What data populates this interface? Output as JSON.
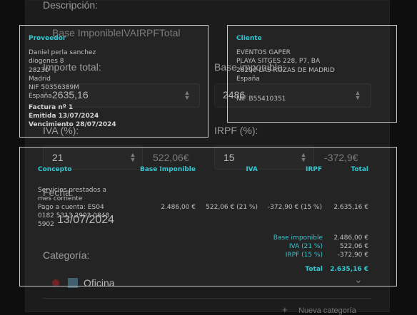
{
  "form": {
    "descripcion_label": "Descripción:",
    "base_header": "Base ImponibleIVAIRPFTotal",
    "importe_total_label": "Importe total:",
    "importe_total_value": "2635,16",
    "base_imponible_label": "Base imponible:",
    "base_imponible_value": "2486",
    "iva_label": "IVA (%):",
    "iva_value": "21",
    "iva_amount": "522,06€",
    "irpf_label": "IRPF (%):",
    "irpf_value": "15",
    "irpf_amount": "-372,9€",
    "fecha_label": "Fecha:",
    "fecha_value": "13/07/2024",
    "categoria_label": "Categoría:",
    "categoria_value": "Oficina",
    "nueva_categoria": "Nueva categoría",
    "plus_glyph": "+",
    "chevron_glyph": "⌄"
  },
  "invoice": {
    "proveedor": {
      "heading": "Proveedor",
      "lines": [
        "Daniel perla sanchez",
        "diogenes 8",
        "28230",
        "Madrid",
        "NIF 50356389M",
        "España"
      ],
      "factura": "Factura nº 1",
      "emitida": "Emitida 13/07/2024",
      "vencimiento": "Vencimiento 28/07/2024"
    },
    "cliente": {
      "heading": "Cliente",
      "lines": [
        "EVENTOS GAPER",
        "PLAYA SITGES 228, P7, BA",
        "28290 LAS ROZAS DE MADRID",
        "España",
        "",
        "NIF B55410351"
      ]
    },
    "table": {
      "headers": [
        "Concepto",
        "Base Imponible",
        "IVA",
        "IRPF",
        "Total"
      ],
      "concepto_lines": [
        "Servicios prestados a",
        "mes corriente",
        "Pago a cuenta: ES04",
        "0182 5313 2903 0848",
        "5902"
      ],
      "base": "2.486,00 €",
      "iva": "522,06 € (21 %)",
      "irpf": "-372,90 € (15 %)",
      "total": "2.635,16 €"
    },
    "summary": {
      "base_label": "Base imponible",
      "base_value": "2.486,00 €",
      "iva_label": "IVA (21 %)",
      "iva_value": "522,06 €",
      "irpf_label": "IRPF (15 %)",
      "irpf_value": "-372,90 €",
      "total_label": "Total",
      "total_value": "2.635,16 €"
    }
  },
  "colors": {
    "accent": "#35c6d1",
    "background": "#0e0e0e",
    "panel": "#1c1c1c"
  }
}
